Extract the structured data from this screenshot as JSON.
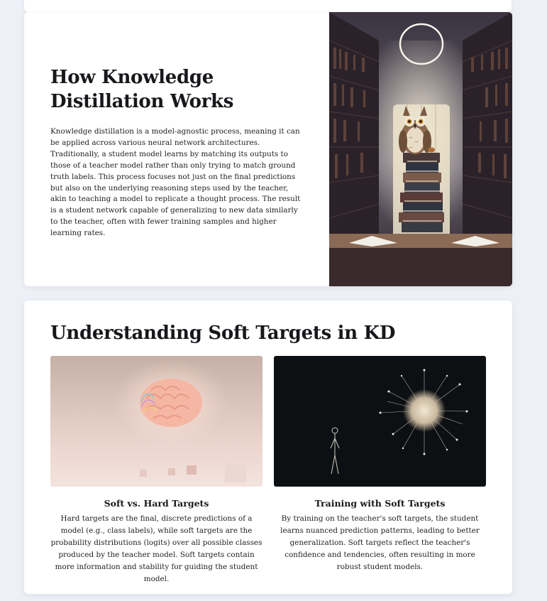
{
  "section1": {
    "title_line1": "How Knowledge",
    "title_line2": "Distillation Works",
    "paragraph": "Knowledge distillation is a model-agnostic process, meaning it can be applied across various neural network architectures. Traditionally, a student model learns by matching its outputs to those of a teacher model rather than only trying to match ground truth labels. This process focuses not just on the final predictions but also on the underlying reasoning steps used by the teacher, akin to teaching a model to replicate a thought process. The result is a student network capable of generalizing to new data similarly to the teacher, often with fewer training samples and higher learning rates."
  },
  "section2": {
    "title": "Understanding Soft Targets in KD",
    "features": [
      {
        "title": "Soft vs. Hard Targets",
        "text": "Hard targets are the final, discrete predictions of a model (e.g., class labels), while soft targets are the probability distributions (logits) over all possible classes produced by the teacher model. Soft targets contain more information and stability for guiding the student model."
      },
      {
        "title": "Training with Soft Targets",
        "text": "By training on the teacher's soft targets, the student learns nuanced prediction patterns, leading to better generalization. Soft targets reflect the teacher's confidence and tendencies, often resulting in more robust student models."
      }
    ]
  }
}
